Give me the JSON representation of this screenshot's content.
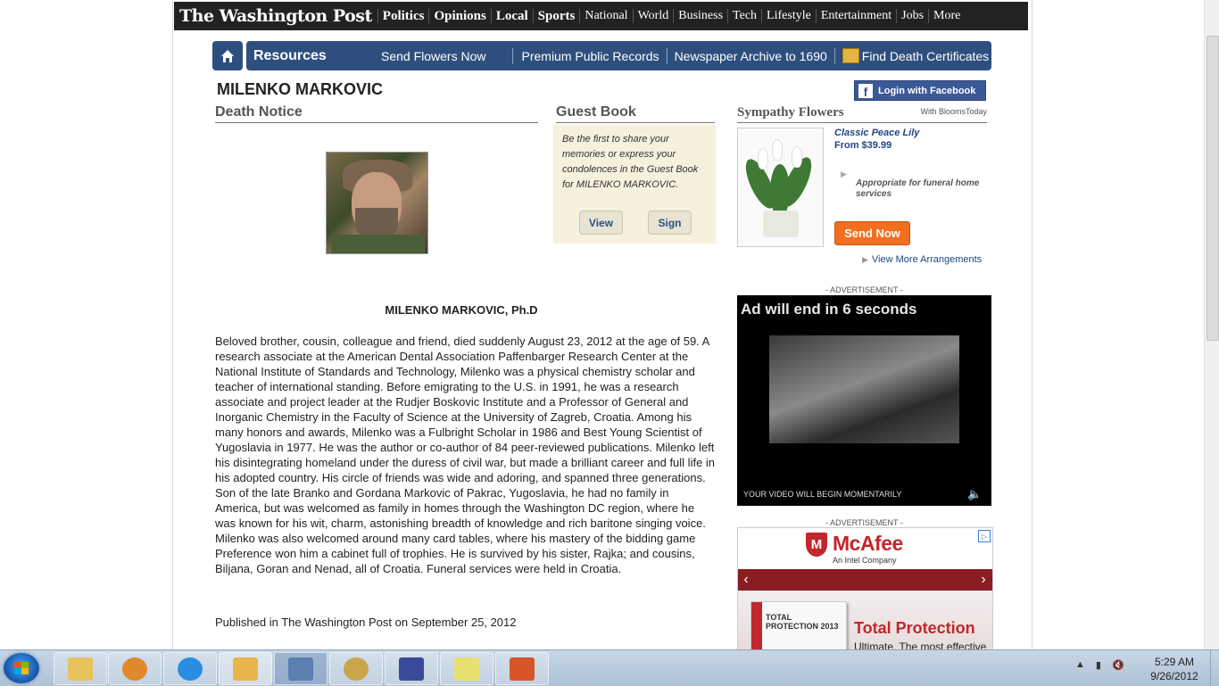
{
  "topnav": {
    "logo": "The Washington Post",
    "items": [
      "Politics",
      "Opinions",
      "Local",
      "Sports",
      "National",
      "World",
      "Business",
      "Tech",
      "Lifestyle",
      "Entertainment",
      "Jobs",
      "More"
    ]
  },
  "resources": {
    "title": "Resources",
    "links": [
      "Send Flowers Now",
      "Premium Public Records",
      "Newspaper Archive to 1690",
      "Find Death Certificates"
    ]
  },
  "facebook": {
    "label": "Login with Facebook"
  },
  "person": {
    "name": "MILENKO MARKOVIC"
  },
  "death_notice": {
    "heading": "Death Notice",
    "obit_title": "MILENKO MARKOVIC, Ph.D",
    "body": "Beloved brother, cousin, colleague and friend, died suddenly August 23, 2012 at the age of 59. A research associate at the American Dental Association Paffenbarger Research Center at the National Institute of Standards and Technology, Milenko was a physical chemistry scholar and teacher of international standing. Before emigrating to the U.S. in 1991, he was a research associate and project leader at the Rudjer Boskovic Institute and a Professor of General and Inorganic Chemistry in the Faculty of Science at the University of Zagreb, Croatia. Among his many honors and awards, Milenko was a Fulbright Scholar in 1986 and Best Young Scientist of Yugoslavia in 1977. He was the author or co-author of 84 peer-reviewed publications. Milenko left his disintegrating homeland under the duress of civil war, but made a brilliant career and full life in his adopted country. His circle of friends was wide and adoring, and spanned three generations. Son of the late Branko and Gordana Markovic of Pakrac, Yugoslavia, he had no family in America, but was welcomed as family in homes through the Washington DC region, where he was known for his wit, charm, astonishing breadth of knowledge and rich baritone singing voice. Milenko was also welcomed around many card tables, where his mastery of the bidding game Preference won him a cabinet full of trophies. He is survived by his sister, Rajka; and cousins, Biljana, Goran and Nenad, all of Croatia. Funeral services were held in Croatia.",
    "published": "Published in The Washington Post on September 25, 2012"
  },
  "guest_book": {
    "heading": "Guest Book",
    "text": "Be the first to share your memories or express your condolences in the Guest Book for MILENKO MARKOVIC.",
    "view_label": "View",
    "sign_label": "Sign"
  },
  "flowers": {
    "heading": "Sympathy Flowers",
    "with": "With BloomsToday",
    "product": "Classic Peace Lily",
    "price": "From $39.99",
    "desc": "Appropriate for funeral home services",
    "send_label": "Send Now",
    "more_label": "View More Arrangements"
  },
  "ads": {
    "label": "- ADVERTISEMENT -",
    "video_title": "Ad will end in 6 seconds",
    "video_footer": "YOUR VIDEO WILL BEGIN MOMENTARILY",
    "mcafee_brand": "McAfee",
    "mcafee_sub": "An Intel Company",
    "box_text": "TOTAL PROTECTION 2013",
    "total_protection": "Total Protection",
    "tagline": "Ultimate. The most effective"
  },
  "taskbar": {
    "time": "5:29 AM",
    "date": "9/26/2012"
  },
  "colors": {
    "nav_bg": "#222222",
    "resources_bg": "#2e4f7e",
    "send_btn": "#f26f1f",
    "mcafee_red": "#c1272d"
  }
}
